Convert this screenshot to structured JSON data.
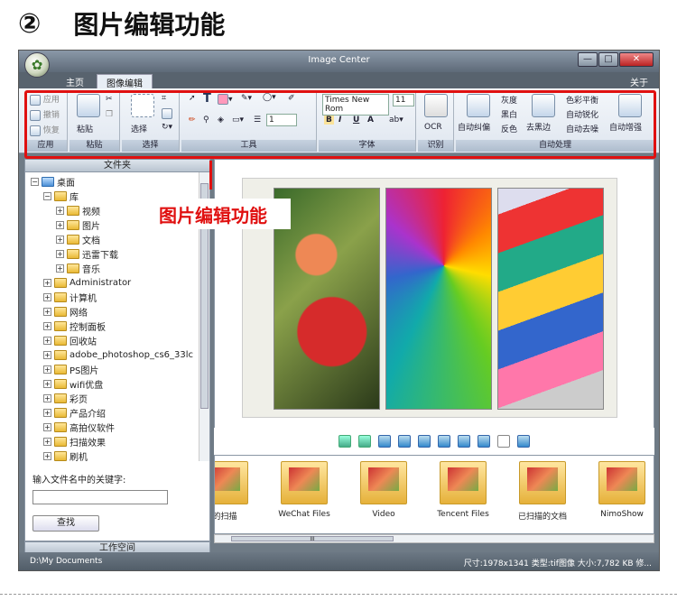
{
  "heading": {
    "num": "②",
    "text": "图片编辑功能"
  },
  "window": {
    "title": "Image Center",
    "buttons": {
      "min": "—",
      "max": "□",
      "close": "✕"
    }
  },
  "tabs": [
    {
      "label": "主页"
    },
    {
      "label": "图像编辑"
    }
  ],
  "about": "关于",
  "ribbon": {
    "app_group": {
      "apply": "应用",
      "undo": "撤销",
      "redo": "恢复",
      "label": "应用"
    },
    "paste_group": {
      "paste": "粘贴",
      "label": "粘贴"
    },
    "select_group": {
      "select": "选择",
      "label": "选择"
    },
    "tools_group": {
      "line_width": "1",
      "label": "工具"
    },
    "font_group": {
      "font_name": "Times New Rom",
      "font_size": "11",
      "bold": "B",
      "italic": "I",
      "underline": "U",
      "color": "A",
      "label": "字体"
    },
    "ocr_group": {
      "ocr": "OCR",
      "label": "识别"
    },
    "auto_group": {
      "auto_skew": "自动纠偏",
      "gray": "灰度",
      "bw": "黑白",
      "invert": "反色",
      "remove_border": "去黑边",
      "color_balance": "色彩平衡",
      "sharpen": "自动锐化",
      "denoise": "自动去噪",
      "enhance": "自动增强",
      "label": "自动处理"
    }
  },
  "left_pane": {
    "header": "文件夹",
    "tree": [
      {
        "label": "桌面",
        "level": 0,
        "icon": "blue"
      },
      {
        "label": "库",
        "level": 1
      },
      {
        "label": "视频",
        "level": 2
      },
      {
        "label": "图片",
        "level": 2
      },
      {
        "label": "文档",
        "level": 2
      },
      {
        "label": "迅雷下载",
        "level": 2
      },
      {
        "label": "音乐",
        "level": 2
      },
      {
        "label": "Administrator",
        "level": 1
      },
      {
        "label": "计算机",
        "level": 1
      },
      {
        "label": "网络",
        "level": 1
      },
      {
        "label": "控制面板",
        "level": 1
      },
      {
        "label": "回收站",
        "level": 1
      },
      {
        "label": "adobe_photoshop_cs6_33lc",
        "level": 1
      },
      {
        "label": "PS图片",
        "level": 1
      },
      {
        "label": "wifi优盘",
        "level": 1
      },
      {
        "label": "彩页",
        "level": 1
      },
      {
        "label": "产品介绍",
        "level": 1
      },
      {
        "label": "高拍仪软件",
        "level": 1
      },
      {
        "label": "扫描效果",
        "level": 1
      },
      {
        "label": "刷机",
        "level": 1
      }
    ],
    "keyword_label": "输入文件名中的关键字:",
    "keyword_value": "",
    "find_button": "查找",
    "workspace": "工作空间"
  },
  "callout": "图片编辑功能",
  "thumbnails": [
    {
      "label": "的扫描"
    },
    {
      "label": "WeChat Files"
    },
    {
      "label": "Video"
    },
    {
      "label": "Tencent Files"
    },
    {
      "label": "已扫描的文档"
    },
    {
      "label": "NimoShow"
    }
  ],
  "hscroll_label": "III",
  "status": {
    "path": "D:\\My Documents",
    "info": "尺寸:1978x1341 类型:tif图像 大小:7,782 KB 修..."
  }
}
